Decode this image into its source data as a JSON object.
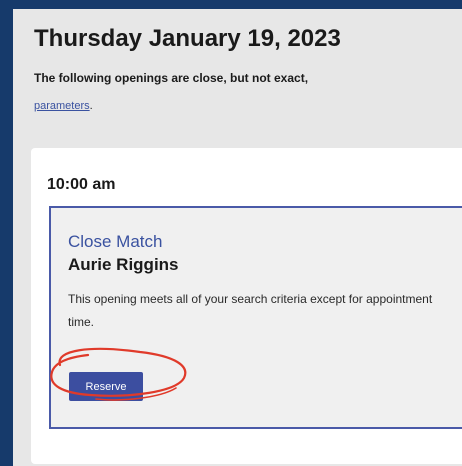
{
  "page": {
    "date_heading": "Thursday January 19, 2023",
    "notice_text": "The following openings are close, but not exact,",
    "params_link": "parameters",
    "params_suffix": "."
  },
  "slot": {
    "time": "10:00 am",
    "opening": {
      "match_type": "Close Match",
      "provider": "Aurie Riggins",
      "description": "This opening meets all of your search criteria except for appointment time.",
      "reserve_label": "Reserve"
    }
  },
  "colors": {
    "background": "#163a6b",
    "accent": "#3c4ea0",
    "annotation": "#e03a2a"
  }
}
